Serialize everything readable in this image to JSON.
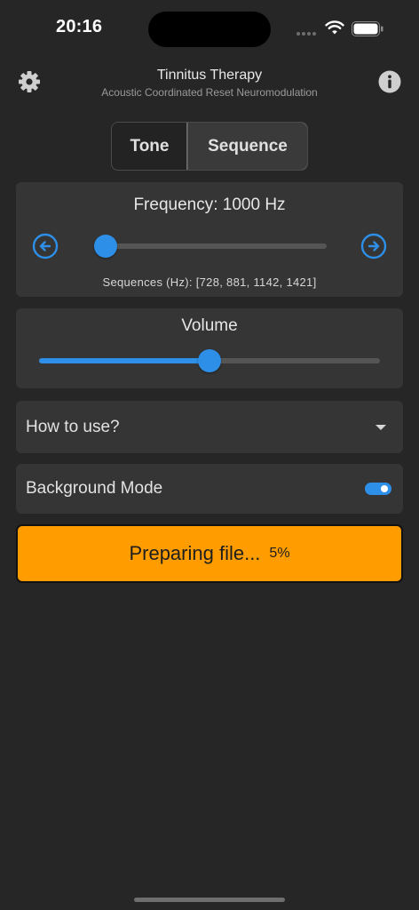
{
  "status_bar": {
    "time": "20:16",
    "battery_level": 1.0
  },
  "header": {
    "title": "Tinnitus Therapy",
    "subtitle": "Acoustic Coordinated Reset Neuromodulation",
    "settings_icon": "gear-icon",
    "info_icon": "info-icon"
  },
  "mode_toggle": {
    "options": [
      "Tone",
      "Sequence"
    ],
    "selected": "Sequence"
  },
  "frequency": {
    "label": "Frequency: 1000 Hz",
    "slider_value": 0.05,
    "sequences_text": "Sequences (Hz): [728, 881, 1142, 1421]",
    "decrease_icon": "arrow-left-circle-icon",
    "increase_icon": "arrow-right-circle-icon"
  },
  "volume": {
    "label": "Volume",
    "slider_value": 0.5
  },
  "how_to_use": {
    "label": "How to use?",
    "icon": "caret-down-icon"
  },
  "background_mode": {
    "label": "Background Mode",
    "enabled": true
  },
  "progress": {
    "label": "Preparing file...",
    "percent_text": "5%",
    "percent": 5
  },
  "colors": {
    "accent": "#2e8fe8",
    "progress_bg": "#ff9c00",
    "background": "#262626",
    "card": "#353535"
  }
}
